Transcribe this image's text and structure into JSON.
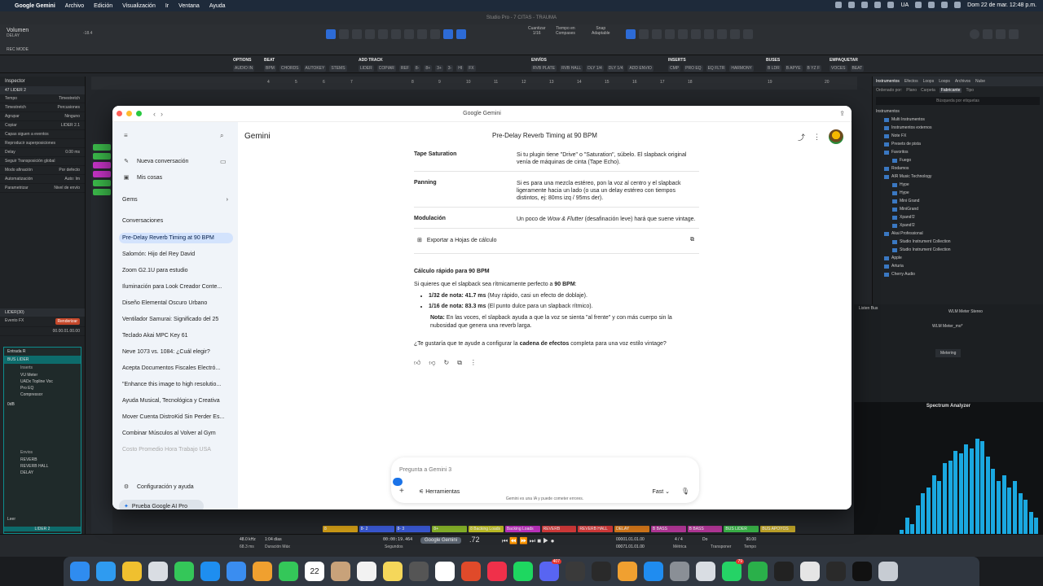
{
  "menubar": {
    "app": "Google Gemini",
    "items": [
      "Archivo",
      "Edición",
      "Visualización",
      "Ir",
      "Ventana",
      "Ayuda"
    ],
    "locale": "UA",
    "datetime": "Dom 22 de mar.   12:48 p.m."
  },
  "daw": {
    "title": "Studio Pro - 7 CITAS - TRAUMA",
    "volume_label": "Volumen",
    "volume_sub": "DELAY",
    "volume_value": "-18.4",
    "rec_mode": "REC MODE",
    "quantize_label": "Cuantizar",
    "quantize_value": "1/16",
    "timebase_label": "Tiempo en",
    "timebase_value": "Compases",
    "snap_label": "Snap",
    "snap_value": "Adaptable",
    "sections": [
      {
        "title": "OPTIONS",
        "items": [
          "AUDIO IN"
        ]
      },
      {
        "title": "BEAT",
        "items": [
          "BPM",
          "CHORDS",
          "AUTOKEY",
          "STEMS"
        ]
      },
      {
        "title": "ADD TRACK",
        "items": [
          "LIDER",
          "COPIAR",
          "REF",
          "8-",
          "8+",
          "3+",
          "3-",
          "HI",
          "FX"
        ]
      },
      {
        "title": "ENVÍOS",
        "items": [
          "RVB PLATE",
          "RVB HALL",
          "DLY 1/4",
          "DLY 1/4",
          "ADD ENVIO"
        ]
      },
      {
        "title": "INSERTS",
        "items": [
          "CMP",
          "PRO EQ",
          "EQ FLTR",
          "HARMONY"
        ]
      },
      {
        "title": "BUSES",
        "items": [
          "B LDR",
          "B APYE",
          "B YZ F"
        ]
      },
      {
        "title": "EMPAQUETAR",
        "items": [
          "VOCES",
          "BEAT"
        ]
      }
    ],
    "ruler_marks": [
      "4",
      "5",
      "6",
      "7",
      "8",
      "9",
      "10",
      "11",
      "12",
      "13",
      "14",
      "15",
      "16",
      "17",
      "18",
      "19",
      "20"
    ],
    "inspector": {
      "title": "Inspector",
      "track": "LIDER 2",
      "track_num": "47",
      "rows": [
        [
          "Tempo",
          "Timestretch"
        ],
        [
          "Timestretch",
          "Percusiones"
        ],
        [
          "Agrupar",
          "Ninguno"
        ],
        [
          "Copiar",
          "LIDER 2.1"
        ],
        [
          "Capas siguen a eventos",
          ""
        ],
        [
          "Reproducir superposiciones",
          ""
        ],
        [
          "Delay",
          "0.00 ms"
        ],
        [
          "Seguir Transposición global",
          ""
        ],
        [
          "Modo afinación",
          "Por defecto"
        ],
        [
          "Automatización",
          "Auto: Im"
        ],
        [
          "Parametrizar",
          "Nivel de envío"
        ]
      ],
      "track2": "LIDER(30)",
      "event_fx": "Evento FX",
      "render": "Renderizar",
      "timecode": "00.00.01.00.00",
      "strip_name": "Entrada R",
      "strip_bus": "BUS LIDER",
      "strip_inserts": [
        "Inserts",
        "VU Meter",
        "UADx Topline Voc",
        "Pro EQ",
        "Compressor"
      ],
      "strip_sends": [
        "Envios",
        "REVERB",
        "REVERB HALL",
        "DELAY"
      ],
      "strip_value": "0dB",
      "strip_label": "LIDER 2",
      "strip_read": "Leer"
    },
    "browser": {
      "tabs": [
        "Instrumentos",
        "Efectos",
        "Loops",
        "Loops",
        "Archivos",
        "Nube"
      ],
      "active_tab": "Instrumentos",
      "sort_label": "Ordenado por:",
      "sort_opts": [
        "Plano",
        "Carpeta",
        "Fabricante",
        "Tipo"
      ],
      "search": "Búsqueda por etiquetas",
      "root": "Instrumentos",
      "items": [
        {
          "label": "Multi Instrumentos",
          "sub": false
        },
        {
          "label": "Instrumentos externos",
          "sub": false
        },
        {
          "label": "Note FX",
          "sub": false
        },
        {
          "label": "Presets de pista",
          "sub": false
        },
        {
          "label": "Favoritos",
          "sub": false
        },
        {
          "label": "Fuego",
          "sub": true
        },
        {
          "label": "Rodamos",
          "sub": false
        },
        {
          "label": "AIR Music Technology",
          "sub": false
        },
        {
          "label": "Hype",
          "sub": true
        },
        {
          "label": "Hype",
          "sub": true
        },
        {
          "label": "Mini Grand",
          "sub": true
        },
        {
          "label": "MiniGrand",
          "sub": true
        },
        {
          "label": "Xpand!2",
          "sub": true
        },
        {
          "label": "Xpand!2",
          "sub": true
        },
        {
          "label": "Akai Professional",
          "sub": false
        },
        {
          "label": "Studio Instrument Collection",
          "sub": true
        },
        {
          "label": "Studio Instrument Collection",
          "sub": true
        },
        {
          "label": "Apple",
          "sub": false
        },
        {
          "label": "Arturia",
          "sub": false
        },
        {
          "label": "Cherry Audio",
          "sub": false
        }
      ]
    },
    "analyzer": {
      "bus": "Listen Bus",
      "plugin1": "WLM Meter Stereo",
      "plugin2": "WLM Meter_mo*",
      "metering": "Metering",
      "title": "Spectrum Analyzer",
      "levels": [
        0.15,
        0.25,
        0.2,
        0.35,
        0.45,
        0.5,
        0.6,
        0.55,
        0.7,
        0.72,
        0.8,
        0.78,
        0.85,
        0.82,
        0.9,
        0.88,
        0.75,
        0.65,
        0.55,
        0.6,
        0.5,
        0.55,
        0.45,
        0.4,
        0.3,
        0.25
      ]
    },
    "colored_tracks": [
      {
        "label": "8",
        "color": "#d4a017"
      },
      {
        "label": "8- 2",
        "color": "#3b5bd9"
      },
      {
        "label": "8- 3",
        "color": "#3b5bd9"
      },
      {
        "label": "8+",
        "color": "#8ab82a"
      },
      {
        "label": "8 Backing Loads",
        "color": "#c4c427"
      },
      {
        "label": "Backing Loads",
        "color": "#c433c4"
      },
      {
        "label": "REVERB",
        "color": "#d93b3b"
      },
      {
        "label": "REVERB HALL",
        "color": "#d93b3b"
      },
      {
        "label": "DELAY",
        "color": "#d97a1a"
      },
      {
        "label": "B BASS",
        "color": "#b8389b"
      },
      {
        "label": "B BASS",
        "color": "#b8389b"
      },
      {
        "label": "BUS LIDER",
        "color": "#3bb84a"
      },
      {
        "label": "BUS APOYOS",
        "color": "#c4a82a"
      }
    ],
    "transport": {
      "sample_rate": "48.0 kHz",
      "duration": "1:04 días",
      "latency": "68.3 ms",
      "max_dur": "Duración Máx",
      "clock": "00:00:19.464",
      "clock_sub": "Segundos",
      "bars": "00001.01.01.00",
      "bars2": "00071.01.01.00",
      "bars_big": ".72",
      "signature": "4 / 4",
      "tempo": "90.00",
      "metric": "Métrica",
      "key": "Do",
      "transpose": "Transponer",
      "tempo_label": "Tempo"
    }
  },
  "window": {
    "title": "Google Gemini"
  },
  "sidebar": {
    "new_chat": "Nueva conversación",
    "my_stuff": "Mis cosas",
    "gems": "Gems",
    "conversations_header": "Conversaciones",
    "conversations": [
      "Pre-Delay Reverb Timing at 90 BPM",
      "Salomón: Hijo del Rey David",
      "Zoom G2.1U para estudio",
      "Iluminación para Look Creador Conte...",
      "Diseño Elemental Oscuro Urbano",
      "Ventilador Samurai: Significado del 25",
      "Teclado Akai MPC Key 61",
      "Neve 1073 vs. 1084: ¿Cuál elegir?",
      "Acepta Documentos Fiscales Electró...",
      "\"Enhance this image to high resolutio...",
      "Ayuda Musical, Tecnológica y Creativa",
      "Mover Cuenta DistroKid Sin Perder Es...",
      "Combinar Músculos al Volver al Gym",
      "Costo Promedio Hora Trabajo USA"
    ],
    "settings": "Configuración y ayuda",
    "try_pro": "Prueba Google AI Pro"
  },
  "main": {
    "brand": "Gemini",
    "conversation_title": "Pre-Delay Reverb Timing at 90 BPM",
    "table": [
      {
        "k": "Tape Saturation",
        "v": "Si tu plugin tiene \"Drive\" o \"Saturation\", súbelo. El slapback original venía de máquinas de cinta (Tape Echo)."
      },
      {
        "k": "Panning",
        "v": "Si es para una mezcla estéreo, pon la voz al centro y el slapback ligeramente hacia un lado (o usa un delay estéreo con tiempos distintos, ej: 80ms izq / 95ms der)."
      },
      {
        "k": "Modulación",
        "v_pre": "Un poco de ",
        "v_em": "Wow & Flutter",
        "v_post": " (desafinación leve) hará que suene vintage."
      }
    ],
    "export": "Exportar a Hojas de cálculo",
    "calc_title": "Cálculo rápido para 90 BPM",
    "intro_pre": "Si quieres que el slapback sea rítmicamente perfecto a ",
    "intro_bold": "90 BPM",
    "intro_post": ":",
    "bullets": [
      {
        "b": "1/32 de nota: 41.7 ms",
        "t": " (Muy rápido, casi un efecto de doblaje)."
      },
      {
        "b": "1/16 de nota: 83.3 ms",
        "t": " (El punto dulce para un slapback rítmico)."
      }
    ],
    "note_bold": "Nota:",
    "note_text": " En las voces, el slapback ayuda a que la voz se sienta \"al frente\" y con más cuerpo sin la nubosidad que genera una reverb larga.",
    "question_pre": "¿Te gustaría que te ayude a configurar la ",
    "question_bold": "cadena de efectos",
    "question_post": " completa para una voz estilo vintage?",
    "prompt_placeholder": "Pregunta a Gemini 3",
    "tools": "Herramientas",
    "mode": "Fast",
    "disclaimer": "Gemini es una IA y puede cometer errores."
  },
  "dock": {
    "tooltip": "Google Gemini",
    "apps": [
      {
        "name": "finder-icon",
        "color": "#2f8cf0"
      },
      {
        "name": "safari-icon",
        "color": "#2f9bf0"
      },
      {
        "name": "chrome-icon",
        "color": "#f0c02f"
      },
      {
        "name": "launchpad-icon",
        "color": "#d9dde3"
      },
      {
        "name": "messages-icon",
        "color": "#34c759"
      },
      {
        "name": "appstore-icon",
        "color": "#1e8ef0"
      },
      {
        "name": "mail-icon",
        "color": "#3a8df0"
      },
      {
        "name": "photos-icon",
        "color": "#f0a02f"
      },
      {
        "name": "facetime-icon",
        "color": "#34c759"
      },
      {
        "name": "calendar-icon",
        "color": "#ffffff",
        "text": "22"
      },
      {
        "name": "contacts-icon",
        "color": "#c8a27a"
      },
      {
        "name": "reminders-icon",
        "color": "#f2f2f2"
      },
      {
        "name": "notes-icon",
        "color": "#f5d75a"
      },
      {
        "name": "calculator-icon",
        "color": "#555555"
      },
      {
        "name": "gemini-icon",
        "color": "#ffffff"
      },
      {
        "name": "studio-one-icon",
        "color": "#e04a2a"
      },
      {
        "name": "music-icon",
        "color": "#f0304a"
      },
      {
        "name": "spotify-icon",
        "color": "#1ed760"
      },
      {
        "name": "discord-icon",
        "color": "#5865f2",
        "badge": "407"
      },
      {
        "name": "link-icon",
        "color": "#3a3a3a"
      },
      {
        "name": "fender-icon",
        "color": "#2a2a2a"
      },
      {
        "name": "pencil-icon",
        "color": "#f0a030"
      },
      {
        "name": "xcode-icon",
        "color": "#1f8cf0"
      },
      {
        "name": "system-settings-icon",
        "color": "#8a8f96"
      },
      {
        "name": "preview-icon",
        "color": "#d9dde3"
      },
      {
        "name": "whatsapp-icon",
        "color": "#25d366",
        "badge": "79"
      },
      {
        "name": "excel-icon",
        "color": "#2ab04a"
      },
      {
        "name": "chatgpt-icon",
        "color": "#222222"
      },
      {
        "name": "blank-app-icon",
        "color": "#e5e5e5"
      },
      {
        "name": "camera-icon",
        "color": "#2a2a2a"
      },
      {
        "name": "capcut-icon",
        "color": "#111111"
      },
      {
        "name": "trash-icon",
        "color": "#c7ccd3"
      }
    ]
  }
}
